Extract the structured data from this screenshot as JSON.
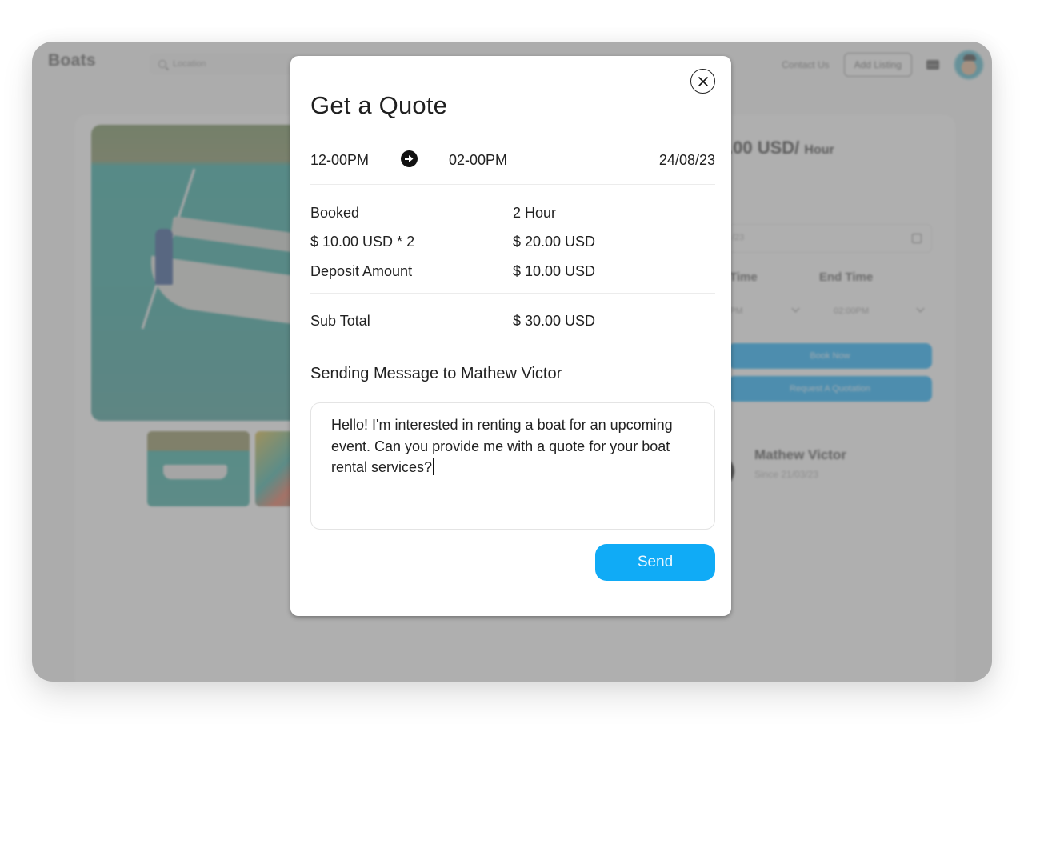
{
  "background": {
    "brand": "Boats",
    "search": {
      "placeholder": "Location",
      "icon": "search-icon"
    },
    "nav": {
      "contact_label": "Contact Us",
      "add_listing_label": "Add Listing",
      "mail_icon": "mail-icon",
      "avatar_icon": "user-avatar"
    },
    "listing": {
      "price_partial": ".00 USD/",
      "price_unit": "Hour",
      "date_partial": "/23",
      "start_time_label_partial": "Time",
      "end_time_label": "End Time",
      "start_time_value_partial": "PM",
      "end_time_value": "02:00PM",
      "book_now_label": "Book Now",
      "request_quotation_label": "Request A Quotation",
      "owner_name": "Mathew Victor",
      "owner_since": "Since 21/03/23"
    }
  },
  "modal": {
    "title": "Get a Quote",
    "close_icon": "close-icon",
    "start_time": "12-00PM",
    "arrow_icon": "arrow-right-circle-icon",
    "end_time": "02-00PM",
    "date": "24/08/23",
    "summary": [
      {
        "label": "Booked",
        "value": "2 Hour"
      },
      {
        "label": "$ 10.00 USD * 2",
        "value": "$ 20.00 USD"
      },
      {
        "label": "Deposit Amount",
        "value": "$ 10.00 USD"
      }
    ],
    "subtotal": {
      "label": "Sub Total",
      "value": "$ 30.00 USD"
    },
    "message_heading": "Sending Message to Mathew Victor",
    "message_value": "Hello! I'm interested in renting a boat for an upcoming event. Can you provide me with a quote for your boat rental services?",
    "send_label": "Send"
  },
  "colors": {
    "accent": "#10abf6",
    "overlay": "#9b9b9b",
    "text": "#1f1f1f"
  }
}
